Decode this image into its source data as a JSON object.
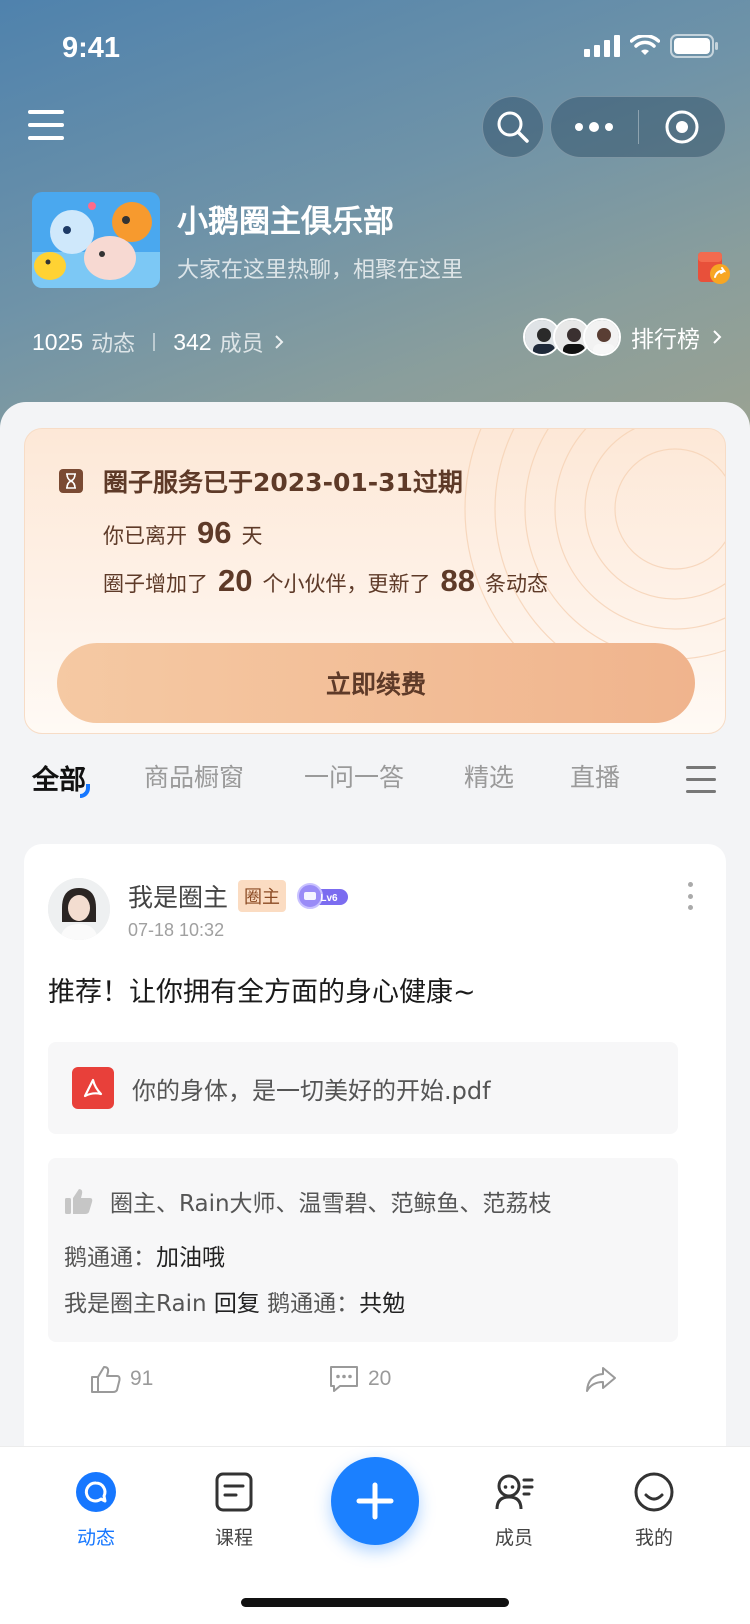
{
  "status_bar": {
    "time": "9:41"
  },
  "circle": {
    "title": "小鹅圈主俱乐部",
    "subtitle": "大家在这里热聊，相聚在这里",
    "posts_count": "1025",
    "posts_label": "动态",
    "members_count": "342",
    "members_label": "成员",
    "ranking_label": "排行榜"
  },
  "expire_notice": {
    "title": "圈子服务已于2023-01-31过期",
    "left_prefix": "你已离开",
    "left_days": "96",
    "left_suffix": "天",
    "growth_prefix": "圈子增加了",
    "new_members": "20",
    "growth_mid": "个小伙伴，更新了",
    "new_posts": "88",
    "growth_suffix": "条动态",
    "renew_label": "立即续费"
  },
  "tabs": [
    "全部",
    "商品橱窗",
    "一问一答",
    "精选",
    "直播"
  ],
  "post": {
    "author": "我是圈主",
    "role_tag": "圈主",
    "level": "Lv6",
    "time": "07-18 10:32",
    "text": "推荐！让你拥有全方面的身心健康~",
    "attachment": "你的身体，是一切美好的开始.pdf",
    "likers": "圈主、Rain大师、温雪碧、范鲸鱼、范荔枝",
    "comment1_user": "鹅通通：",
    "comment1_text": "加油哦",
    "comment2_user": "我是圈主Rain",
    "comment2_reply": "回复",
    "comment2_target": "鹅通通：",
    "comment2_text": "共勉",
    "like_count": "91",
    "comment_count": "20"
  },
  "tabbar": {
    "feed": "动态",
    "course": "课程",
    "members": "成员",
    "mine": "我的"
  },
  "colors": {
    "accent": "#1677ff",
    "expire_text": "#5e3a28",
    "renew_button": "#f0b48d"
  }
}
